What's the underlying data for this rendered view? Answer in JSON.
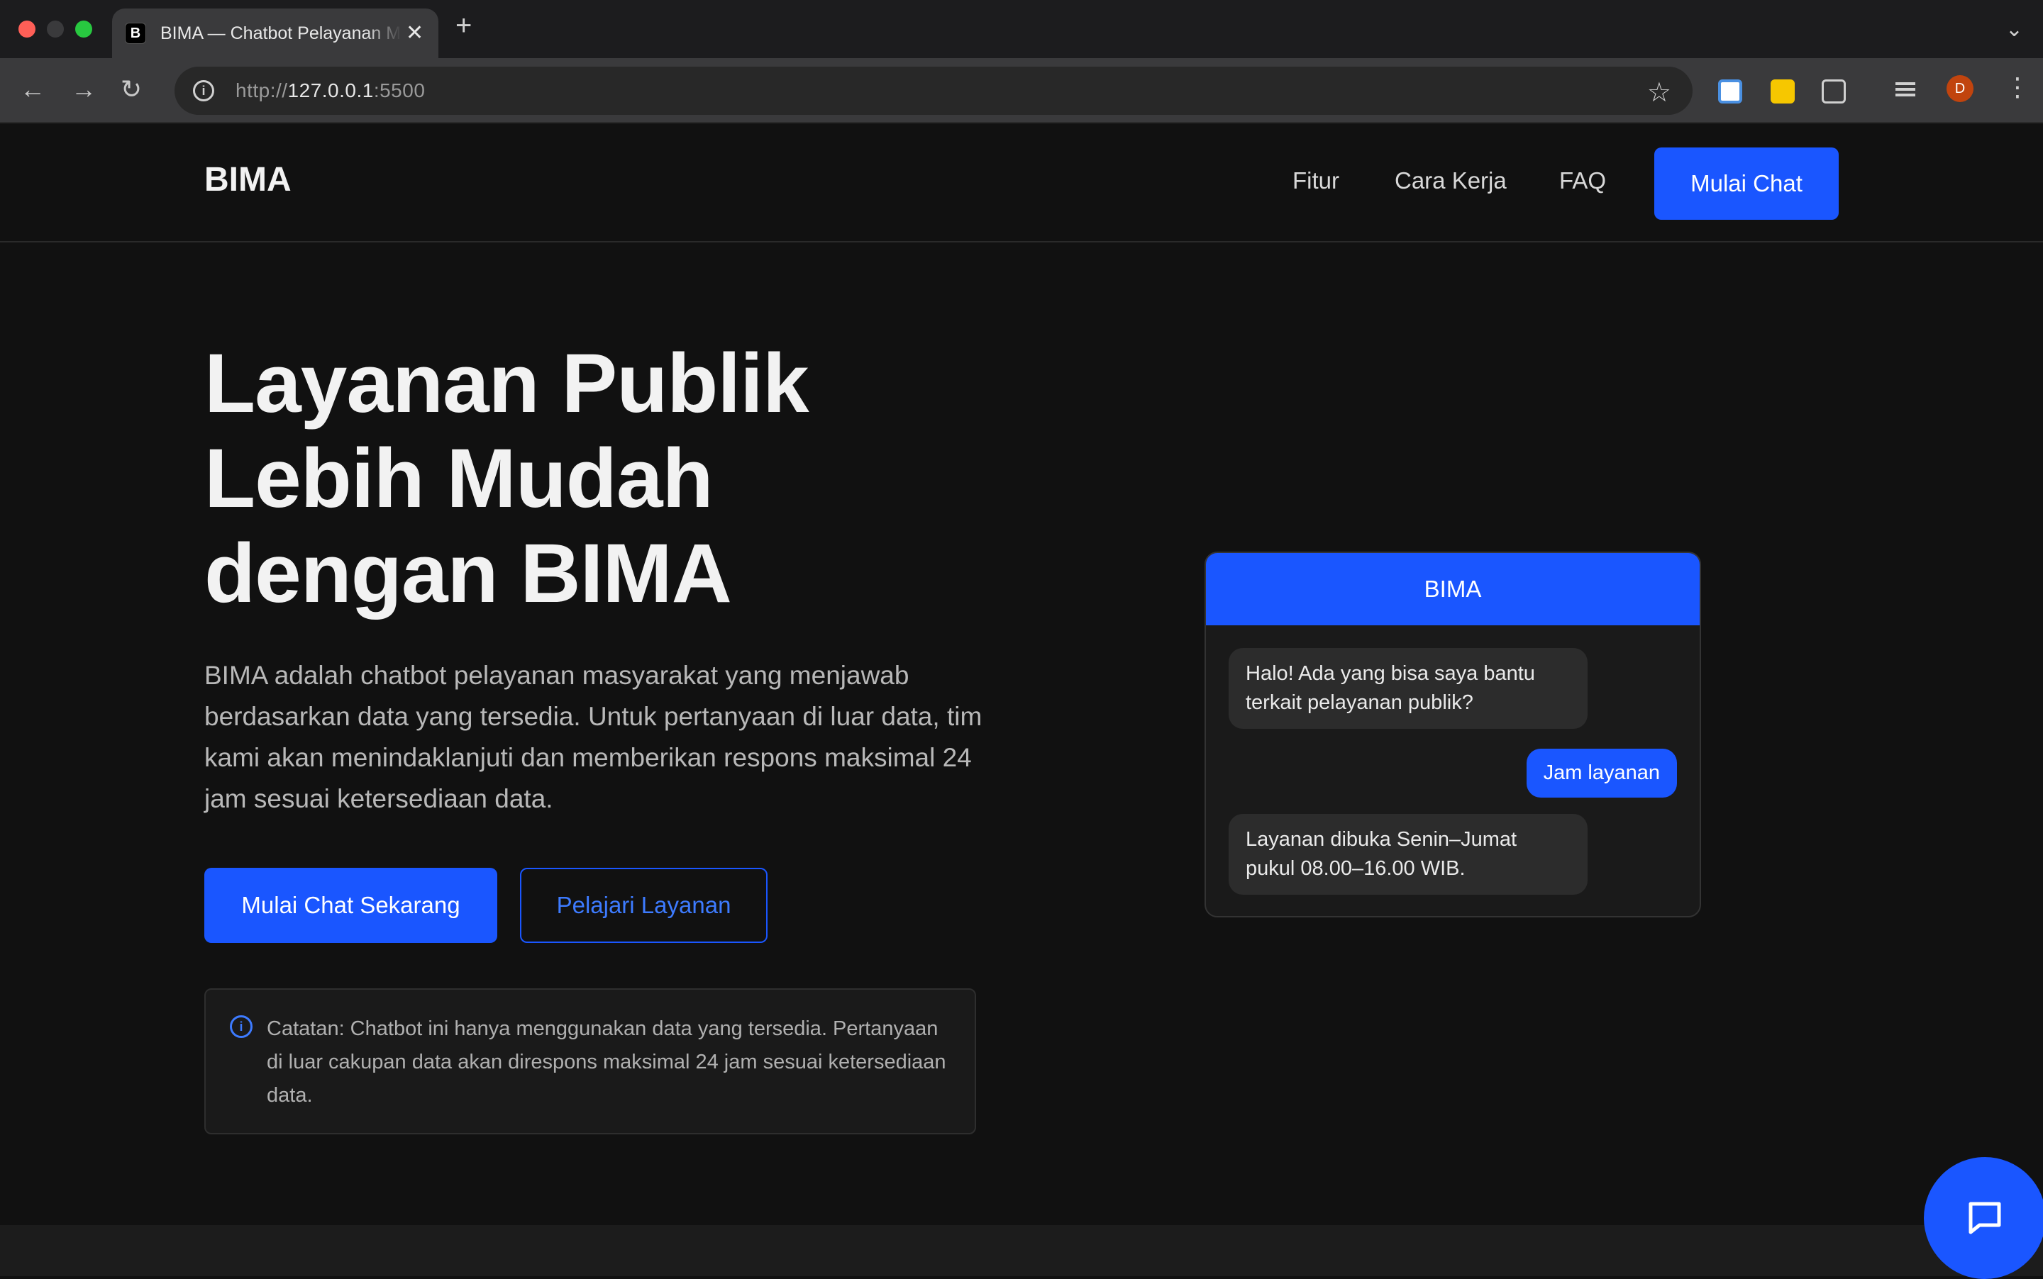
{
  "browser": {
    "tab_favicon": "B",
    "tab_title": "BIMA — Chatbot Pelayanan Masyarakat",
    "tab_close": "✕",
    "new_tab": "+",
    "url_scheme": "http://",
    "url_host": "127.0.0.1",
    "url_port": ":5500",
    "avatar_initial": "D"
  },
  "header": {
    "brand": "BIMA",
    "nav": [
      "Fitur",
      "Cara Kerja",
      "FAQ"
    ],
    "cta": "Mulai Chat"
  },
  "hero": {
    "title_lines": [
      "Layanan Publik",
      "Lebih Mudah",
      "dengan BIMA"
    ],
    "description": "BIMA adalah chatbot pelayanan masyarakat yang menjawab berdasarkan data yang tersedia. Untuk pertanyaan di luar data, tim kami akan menindaklanjuti dan memberikan respons maksimal 24 jam sesuai ketersediaan data.",
    "primary_button": "Mulai Chat Sekarang",
    "secondary_button": "Pelajari Layanan",
    "note": "Catatan: Chatbot ini hanya menggunakan data yang tersedia. Pertanyaan di luar cakupan data akan direspons maksimal 24 jam sesuai ketersediaan data."
  },
  "chat_preview": {
    "title": "BIMA",
    "messages": [
      {
        "from": "bot",
        "text": "Halo! Ada yang bisa saya bantu terkait pelayanan publik?"
      },
      {
        "from": "user",
        "text": "Jam layanan"
      },
      {
        "from": "bot",
        "text": "Layanan dibuka Senin–Jumat pukul 08.00–16.00 WIB."
      }
    ]
  },
  "colors": {
    "accent": "#1a56ff",
    "background": "#111111",
    "surface": "#1a1a1a"
  },
  "icons": {
    "info": "info-icon",
    "fab": "chat-bubble-icon"
  }
}
